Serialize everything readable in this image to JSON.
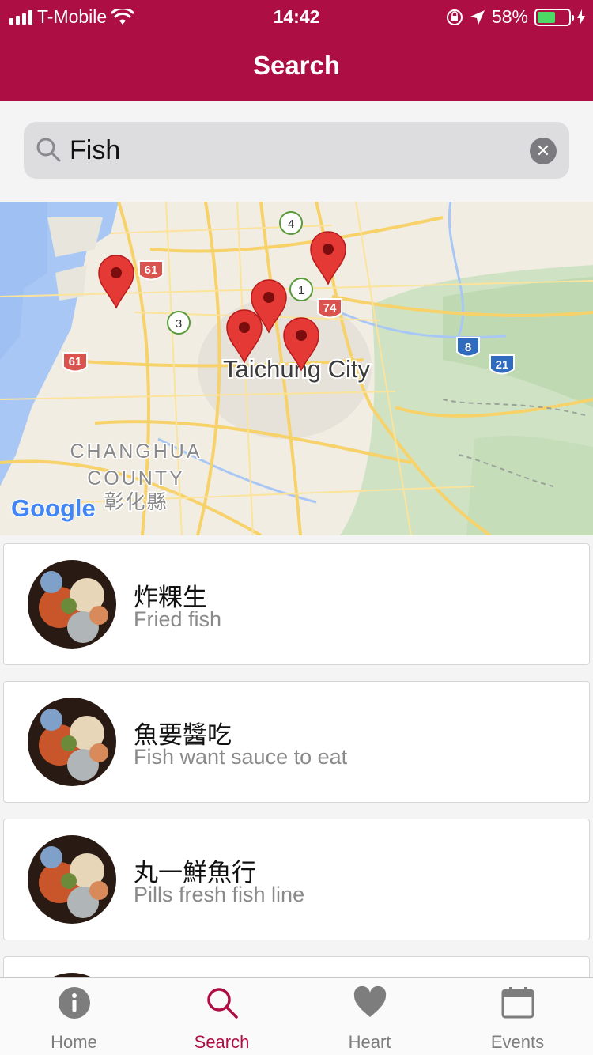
{
  "status_bar": {
    "carrier": "T-Mobile",
    "time": "14:42",
    "battery": "58%",
    "battery_level": 0.58
  },
  "header": {
    "title": "Search"
  },
  "search": {
    "value": "Fish",
    "placeholder": ""
  },
  "map": {
    "city_label": "Taichung City",
    "county_label_1": "CHANGHUA",
    "county_label_2": "COUNTY",
    "county_label_zh": "彰化縣",
    "logo": "Google",
    "road_shields": [
      "61",
      "61",
      "74",
      "8",
      "21"
    ],
    "flower_markers": [
      "4",
      "1",
      "3"
    ]
  },
  "results": [
    {
      "name": "炸粿生",
      "subtitle": "Fried fish"
    },
    {
      "name": "魚要醬吃",
      "subtitle": "Fish want sauce to eat"
    },
    {
      "name": "丸一鮮魚行",
      "subtitle": "Pills fresh fish line"
    }
  ],
  "tabs": [
    {
      "label": "Home",
      "icon": "info-icon"
    },
    {
      "label": "Search",
      "icon": "search-icon"
    },
    {
      "label": "Heart",
      "icon": "heart-icon"
    },
    {
      "label": "Events",
      "icon": "calendar-icon"
    }
  ],
  "colors": {
    "brand": "#ad0e43",
    "inactive_tab": "#7d7d7d",
    "pin": "#e53935"
  }
}
